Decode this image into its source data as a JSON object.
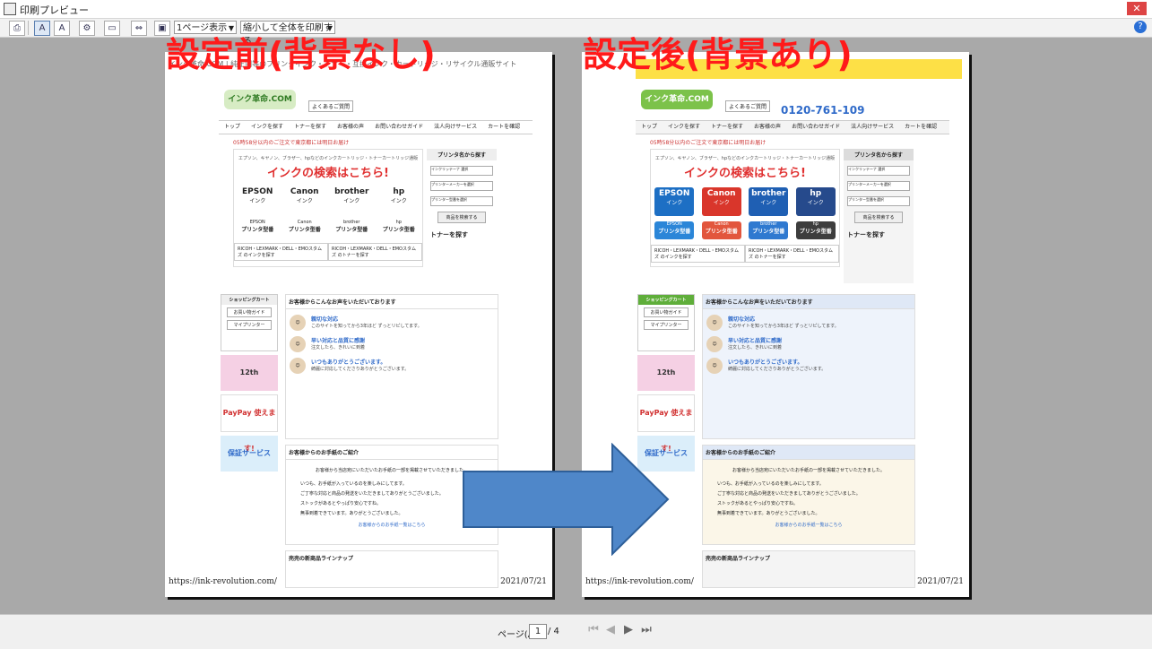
{
  "window": {
    "title": "印刷プレビュー"
  },
  "toolbar": {
    "view_select": "1ページ表示",
    "scale_select": "縮小して全体を印刷する",
    "help_label": "?"
  },
  "captions": {
    "before": "設定前(背景なし)",
    "after": "設定後(背景あり)"
  },
  "pages": {
    "header_text": "インク革命.COM | 純正同等のプリンタインク・トナー・互換インク・カートリッジ・リサイクル通販サイト",
    "url": "https://ink-revolution.com/",
    "date": "2021/07/21"
  },
  "site": {
    "logo": "インク革命.COM",
    "logo_sub": "おかげさまで12周年",
    "faq": "よくあるご質問",
    "phone": "0120-761-109",
    "nav": [
      "トップ",
      "インクを探す",
      "トナーを探す",
      "お客様の声",
      "お問い合わせガイド",
      "法人向けサービス",
      "カートを確認"
    ],
    "deadline": "05時58分以内のご注文で東京都には明日お届け",
    "hero_sub": "エプソン、キヤノン、ブラザー、hpなどのインクカートリッジ・トナーカートリッジ通販",
    "hero_title": "インクの検索はこちら!",
    "brands": [
      {
        "name": "EPSON",
        "sub": "インク",
        "color": "#1d6fc4"
      },
      {
        "name": "Canon",
        "sub": "インク",
        "color": "#d9362b"
      },
      {
        "name": "brother",
        "sub": "インク",
        "color": "#1f5fb3"
      },
      {
        "name": "hp",
        "sub": "インク",
        "color": "#264a8c"
      }
    ],
    "brand2": [
      {
        "name": "EPSON",
        "sub": "プリンタ型番",
        "color": "#2b86d8"
      },
      {
        "name": "Canon",
        "sub": "プリンタ型番",
        "color": "#e2563d"
      },
      {
        "name": "brother",
        "sub": "プリンタ型番",
        "color": "#2f79d0"
      },
      {
        "name": "hp",
        "sub": "プリンタ型番",
        "color": "#3d3d3d"
      }
    ],
    "ricoh": [
      "RICOH・LEXMARK・DELL・EMOスタムズ のインクを探す",
      "RICOH・LEXMARK・DELL・EMOスタムズ のトナーを探す"
    ],
    "side_title": "プリンタ名から探す",
    "side_selects": [
      "インクリッテーナ 選択",
      "プリンターメーカーを選択",
      "プリンター型番を選択"
    ],
    "side_button": "商品を検索する",
    "toner_title": "トナーを探す",
    "cart_title": "ショッピングカート",
    "cart_buttons": [
      "お買い物ガイド",
      "マイプリンター"
    ],
    "banners": [
      "12th",
      "PayPay 使えます!",
      "保証サービス"
    ],
    "reviews_title": "お客様からこんなお声をいただいております",
    "reviews": [
      {
        "title": "親切な対応",
        "text": "このサイトを知ってから3年ほど ずっとリピしてます。"
      },
      {
        "title": "早い対応と品質に感謝",
        "text": "注文したら、きれいに到着"
      },
      {
        "title": "いつもありがとうございます。",
        "text": "綺麗に対応してくださりありがとうございます。"
      }
    ],
    "voice_title": "お客様からのお手紙のご紹介",
    "voice_intro": "お客様から当店宛にいただいたお手紙の一部を掲載させていただきました。",
    "voice_items": [
      "いつも、お手紙が入っているのを楽しみにしてます。",
      "ご丁寧な対応と商品の発送をいただきましてありがとうございました。",
      "ストックがあるとやっぱり安心ですね。",
      "無事到着できています。ありがとうございました。"
    ],
    "voice_more": "お客様からのお手紙一覧はこちら",
    "new_items": "売売の新商品ラインナップ"
  },
  "bottom": {
    "page_label": "ページ(A)",
    "page_value": "1",
    "page_total": "/ 4"
  },
  "colors": {
    "caption": "#ff1a1a",
    "arrow": "#4f87c9",
    "arrow_border": "#2e5f99"
  }
}
